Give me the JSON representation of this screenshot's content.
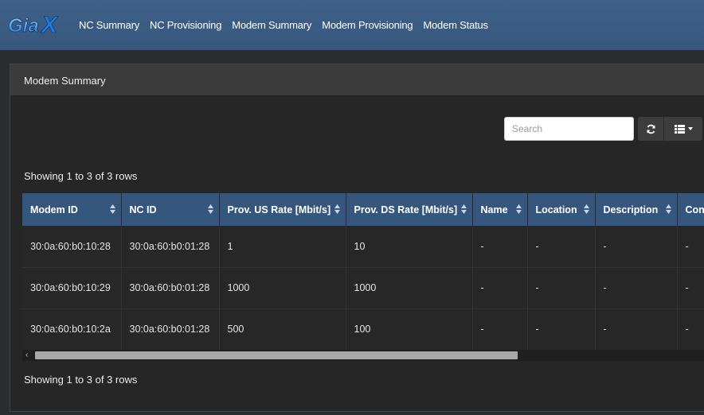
{
  "brand": {
    "logo_text": "GiaX"
  },
  "nav": {
    "items": [
      {
        "label": "NC Summary"
      },
      {
        "label": "NC Provisioning"
      },
      {
        "label": "Modem Summary"
      },
      {
        "label": "Modem Provisioning"
      },
      {
        "label": "Modem Status"
      }
    ]
  },
  "panel": {
    "title": "Modem Summary"
  },
  "toolbar": {
    "search_placeholder": "Search",
    "refresh_icon": "refresh-icon",
    "columns_icon": "columns-list-icon"
  },
  "pagination": {
    "top": "Showing 1 to 3 of 3 rows",
    "bottom": "Showing 1 to 3 of 3 rows"
  },
  "table": {
    "columns": [
      "Modem ID",
      "NC ID",
      "Prov. US Rate [Mbit/s]",
      "Prov. DS Rate [Mbit/s]",
      "Name",
      "Location",
      "Description",
      "Con"
    ],
    "rows": [
      [
        "30:0a:60:b0:10:28",
        "30:0a:60:b0:01:28",
        "1",
        "10",
        "-",
        "-",
        "-",
        "-"
      ],
      [
        "30:0a:60:b0:10:29",
        "30:0a:60:b0:01:28",
        "1000",
        "1000",
        "-",
        "-",
        "-",
        "-"
      ],
      [
        "30:0a:60:b0:10:2a",
        "30:0a:60:b0:01:28",
        "500",
        "100",
        "-",
        "-",
        "-",
        "-"
      ]
    ]
  },
  "colors": {
    "navbar": "#3f6188",
    "header": "#36577d",
    "panel_bg": "#262626",
    "page_bg": "#2b2c2e"
  }
}
